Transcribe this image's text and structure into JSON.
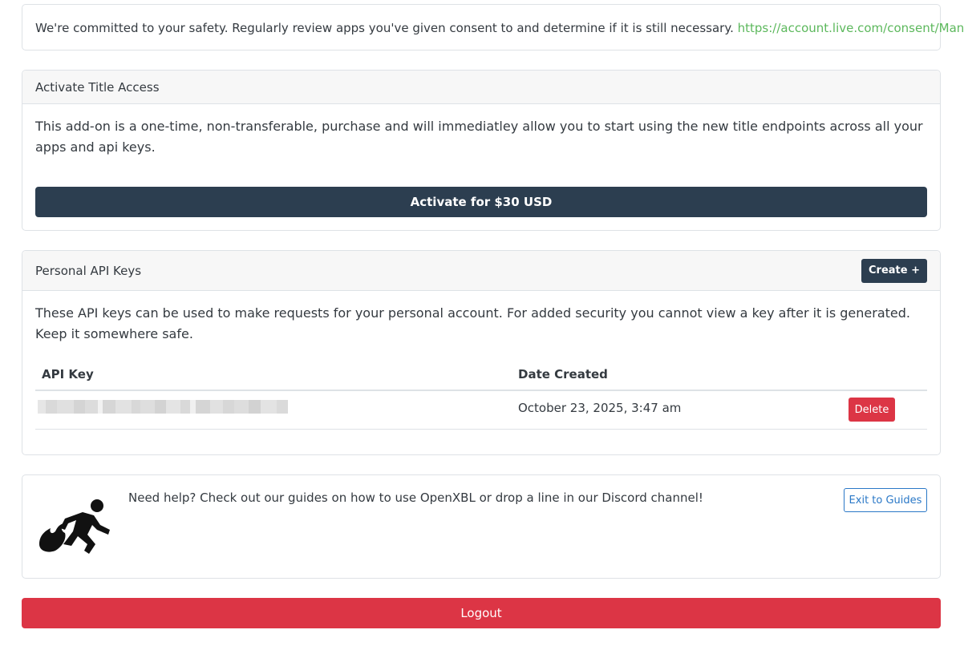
{
  "safety": {
    "message": "We're committed to your safety. Regularly review apps you've given consent to and determine if it is still necessary.",
    "link": "https://account.live.com/consent/Manage"
  },
  "title_access": {
    "header": "Activate Title Access",
    "description": "This add-on is a one-time, non-transferable, purchase and will immediatley allow you to start using the new title endpoints across all your apps and api keys.",
    "activate_label": "Activate for $30 USD"
  },
  "api_keys": {
    "header": "Personal API Keys",
    "create_label": "Create +",
    "description": "These API keys can be used to make requests for your personal account. For added security you cannot view a key after it is generated. Keep it somewhere safe.",
    "columns": [
      "API Key",
      "Date Created"
    ],
    "rows": [
      {
        "date_created": "October 23, 2025, 3:47 am",
        "delete_label": "Delete"
      }
    ]
  },
  "help": {
    "message": "Need help? Check out our guides on how to use OpenXBL or drop a line in our Discord channel!",
    "guides_label": "Exit to Guides",
    "logo_icon": "running-figure-fire-icon"
  },
  "logout_label": "Logout",
  "colors": {
    "primary_dark": "#2c3e50",
    "danger": "#dc3545",
    "link_green": "#5cb85c",
    "guides_blue": "#2a78c7"
  }
}
